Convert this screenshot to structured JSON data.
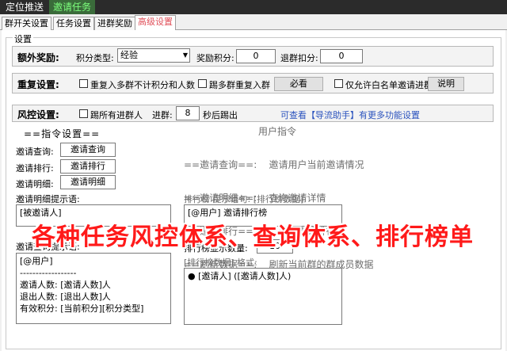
{
  "top_tabs": [
    "定位推送",
    "邀请任务"
  ],
  "sub_tabs": [
    "群开关设置",
    "任务设置",
    "进群奖励",
    "高级设置"
  ],
  "group_title": "设置",
  "extra": {
    "label": "额外奖励:",
    "type_label": "积分类型:",
    "type_value": "经验",
    "reward_label": "奖励积分:",
    "reward_value": "0",
    "quit_label": "退群扣分:",
    "quit_value": "0"
  },
  "repeat": {
    "label": "重复设置:",
    "opt1": "重复入多群不计积分和人数",
    "opt2": "踢多群重复入群",
    "must_btn": "必看",
    "opt3": "仅允许白名单邀请进群",
    "explain_btn": "说明"
  },
  "risk": {
    "label": "风控设置:",
    "opt": "踢所有进群人",
    "join_label": "进群:",
    "seconds": "8",
    "sec_label": "秒后踢出",
    "link": "可查看【导流助手】有更多功能设置"
  },
  "commands": {
    "title": "==指令设置==",
    "rows": [
      {
        "label": "邀请查询:",
        "value": "邀请查询"
      },
      {
        "label": "邀请排行:",
        "value": "邀请排行"
      },
      {
        "label": "邀请明细:",
        "value": "邀请明细"
      }
    ],
    "user_title": "用户指令",
    "user_lines": [
      "==邀请查询==:    邀请用户当前邀请情况",
      "==邀请明细==:    查询邀请详情",
      "==邀请排行==:    当前群邀请排行榜",
      "==刷新数据==:    刷新当前群的群成员数据"
    ]
  },
  "detail_hint": {
    "label": "邀请明细提示语:",
    "text": "[被邀请人]"
  },
  "rank_hint": {
    "label": "排行榜 提示语句:",
    "label2": "[排行榜数据]",
    "text": "[@用户] 邀请排行榜"
  },
  "query_hint": {
    "label": "邀请查询提示语:",
    "lines": [
      "[@用户]",
      "------------------",
      "邀请人数: [邀请人数]人",
      "退出人数: [退出人数]人",
      "有效积分: [当前积分][积分类型]"
    ]
  },
  "rank_count": {
    "label": "排行榜显示数量:",
    "value": "10"
  },
  "rank_format": {
    "label": "[排行榜数据]",
    "label2": "格式:",
    "text": "● [邀请人]  ([邀请人数]人)"
  },
  "overlay_text": "各种任务风控体系、查询体系、排行榜单"
}
